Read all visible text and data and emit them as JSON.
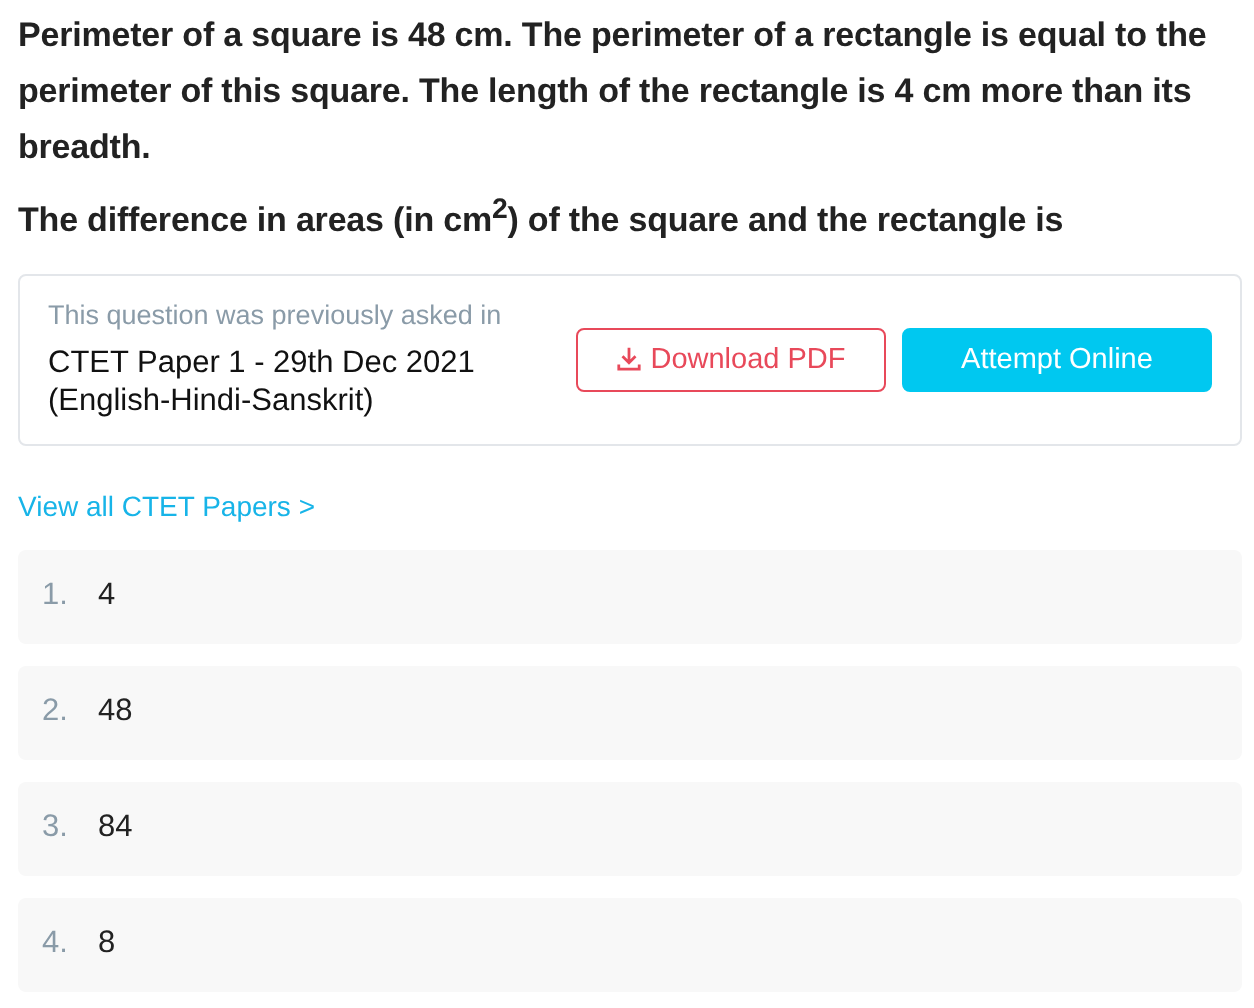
{
  "question": {
    "paragraphs": [
      "Perimeter of a square is 48 cm. The perimeter of a rectangle is equal to the perimeter of this square. The length of the rectangle is 4 cm more than its breadth.",
      "The difference in areas (in cm$^{2}$) of the square and the rectangle is"
    ]
  },
  "source_card": {
    "caption": "This question was previously asked in",
    "paper": "CTET Paper 1 - 29th Dec 2021 (English-Hindi-Sanskrit)",
    "download_button": "Download PDF",
    "attempt_button": "Attempt Online"
  },
  "papers_link": "View all CTET Papers >",
  "options": [
    {
      "number": "1.",
      "text": "4"
    },
    {
      "number": "2.",
      "text": "48"
    },
    {
      "number": "3.",
      "text": "84"
    },
    {
      "number": "4.",
      "text": "8"
    }
  ]
}
